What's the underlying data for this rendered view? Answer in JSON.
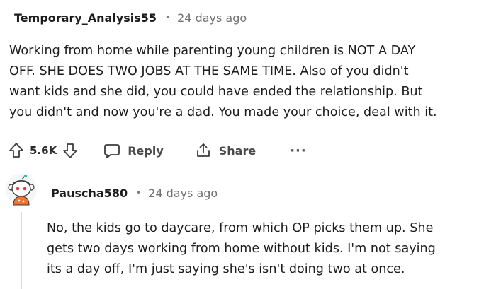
{
  "comment1": {
    "username": "Temporary_Analysis55",
    "separator": "•",
    "time": "24 days ago",
    "lines": [
      "Working from home while parenting young children is NOT A DAY",
      "OFF. SHE DOES TWO JOBS AT THE SAME TIME. Also of you didn't",
      "want kids and she did, you could have ended the relationship. But",
      "you didn't and now you're a dad. You made your choice, deal with it."
    ],
    "actions": {
      "vote_count": "5.6K",
      "reply_label": "Reply",
      "share_label": "Share",
      "more_label": "···"
    }
  },
  "comment2": {
    "username": "Pauscha580",
    "separator": "•",
    "time": "24 days ago",
    "lines": [
      "No, the kids go to daycare, from which OP picks them up. She",
      "gets two days working from home without kids. I'm not saying",
      "its a day off, I'm just saying she's isn't doing two at once."
    ]
  },
  "colors": {
    "text": "#1c1c1c",
    "meta": "#6f6f6f",
    "avatar_hat": "#f3722c",
    "avatar_face": "#ffffff",
    "avatar_accent": "#2ec4a6"
  }
}
